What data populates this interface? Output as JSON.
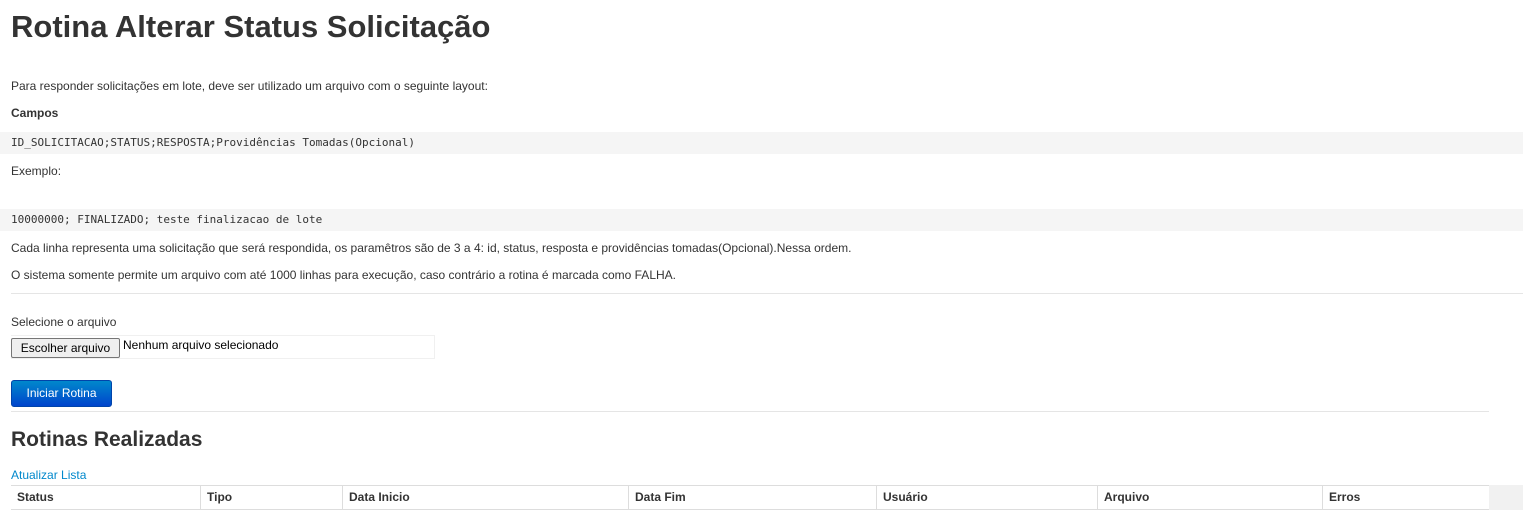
{
  "page_title": "Rotina Alterar Status Solicitação",
  "intro": "Para responder solicitações em lote, deve ser utilizado um arquivo com o seguinte layout:",
  "fields_heading": "Campos",
  "fields_code": "ID_SOLICITACAO;STATUS;RESPOSTA;Providências Tomadas(Opcional)",
  "example_label": "Exemplo:",
  "example_code": "10000000; FINALIZADO; teste finalizacao de lote",
  "explanation_1": "Cada linha representa uma solicitação que será respondida, os paramêtros são de 3 a 4: id, status, resposta e providências tomadas(Opcional).Nessa ordem.",
  "explanation_2": "O sistema somente permite um arquivo com até 1000 linhas para execução, caso contrário a rotina é marcada como FALHA.",
  "upload": {
    "label": "Selecione o arquivo",
    "button_label": "Escolher arquivo",
    "status_text": "Nenhum arquivo selecionado"
  },
  "start_button_label": "Iniciar Rotina",
  "routines_heading": "Rotinas Realizadas",
  "refresh_link_label": "Atualizar Lista",
  "table": {
    "columns": [
      "Status",
      "Tipo",
      "Data Inicio",
      "Data Fim",
      "Usuário",
      "Arquivo",
      "Erros"
    ]
  },
  "colors": {
    "primary_button": "#0055cc",
    "link": "#0088cc",
    "code_background": "#f5f5f5"
  }
}
